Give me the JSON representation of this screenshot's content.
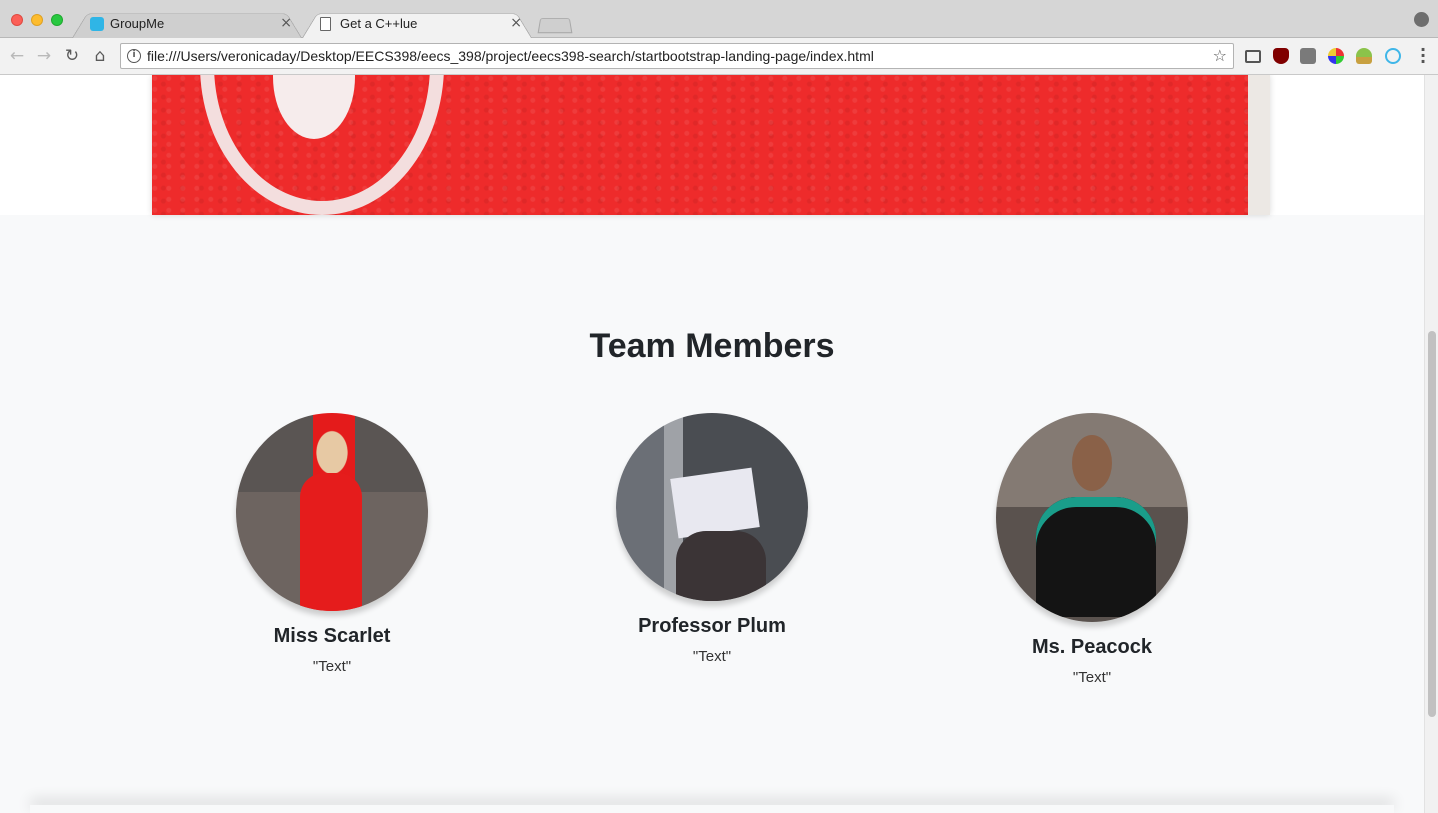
{
  "browser": {
    "tabs": [
      {
        "label": "GroupMe",
        "icon": "groupme-icon",
        "active": false
      },
      {
        "label": "Get a C++lue",
        "icon": "document-icon",
        "active": true
      }
    ],
    "tab_close_glyph": "×",
    "url": "file:///Users/veronicaday/Desktop/EECS398/eecs_398/project/eecs398-search/startbootstrap-landing-page/index.html"
  },
  "page": {
    "section_title": "Team Members",
    "members": [
      {
        "name": "Miss Scarlet",
        "quote": "\"Text\""
      },
      {
        "name": "Professor Plum",
        "quote": "\"Text\""
      },
      {
        "name": "Ms. Peacock",
        "quote": "\"Text\""
      }
    ]
  },
  "colors": {
    "hero_red": "#ee2b2b",
    "section_background": "#f8f9fa",
    "heading_text": "#212529"
  }
}
